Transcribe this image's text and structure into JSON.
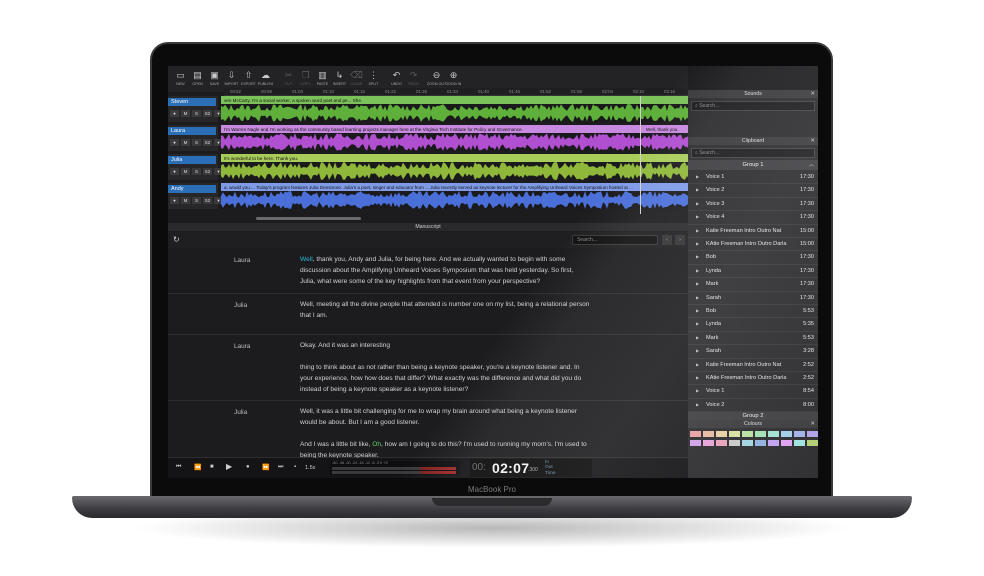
{
  "device": {
    "label": "MacBook Pro"
  },
  "toolbar": [
    {
      "icon": "new-icon",
      "glyph": "▭",
      "label": "NEW",
      "enabled": true
    },
    {
      "icon": "open-icon",
      "glyph": "▤",
      "label": "OPEN",
      "enabled": true
    },
    {
      "icon": "save-icon",
      "glyph": "▣",
      "label": "SAVE",
      "enabled": true
    },
    {
      "icon": "import-icon",
      "glyph": "⇩",
      "label": "IMPORT",
      "enabled": true
    },
    {
      "icon": "export-icon",
      "glyph": "⇧",
      "label": "EXPORT",
      "enabled": true
    },
    {
      "icon": "publish-icon",
      "glyph": "☁",
      "label": "PUBLISH",
      "enabled": true
    },
    {
      "icon": "cut-icon",
      "glyph": "✂",
      "label": "CUT",
      "enabled": false
    },
    {
      "icon": "copy-icon",
      "glyph": "❐",
      "label": "COPY",
      "enabled": false
    },
    {
      "icon": "paste-icon",
      "glyph": "▥",
      "label": "PASTE",
      "enabled": true
    },
    {
      "icon": "insert-icon",
      "glyph": "↳",
      "label": "INSERT",
      "enabled": true
    },
    {
      "icon": "clear-icon",
      "glyph": "⌫",
      "label": "CLEAR",
      "enabled": false
    },
    {
      "icon": "split-icon",
      "glyph": "⋮",
      "label": "SPLIT",
      "enabled": true
    },
    {
      "icon": "undo-icon",
      "glyph": "↶",
      "label": "UNDO",
      "enabled": true
    },
    {
      "icon": "redo-icon",
      "glyph": "↷",
      "label": "REDO",
      "enabled": false
    },
    {
      "icon": "zoom-out-icon",
      "glyph": "⊖",
      "label": "ZOOM OUT",
      "enabled": true
    },
    {
      "icon": "zoom-in-icon",
      "glyph": "⊕",
      "label": "ZOOM IN",
      "enabled": true
    }
  ],
  "ruler_ticks": [
    "00:52",
    "00:58",
    "01:04",
    "01:10",
    "01:16",
    "01:22",
    "01:28",
    "01:34",
    "01:40",
    "01:46",
    "01:52",
    "01:58",
    "02:04",
    "02:10",
    "02:16"
  ],
  "tracks": [
    {
      "name": "Steven",
      "color": "#5fb03a",
      "label_bg": "#7cc25a",
      "text": "ven McCarty. I'm a social worker, a spoken word poet and pe... She.",
      "text2": ""
    },
    {
      "name": "Laura",
      "color": "#b04fd0",
      "label_bg": "#c88ae0",
      "text": "I'm Warren Nagle and I'm working as the community based learning projects manager here at the Virginia Tech Institute for Policy and Governance.",
      "text2": "Well, thank you."
    },
    {
      "name": "Julia",
      "color": "#8fb83a",
      "label_bg": "#a8cc5a",
      "text": "It's wonderful to be here. Thank you.",
      "text2": ""
    },
    {
      "name": "Andy",
      "color": "#4a6fd8",
      "label_bg": "#7f9be8",
      "text": "a, would you ... Today's program features Julia Densmore. Julia's a poet, singer and educator from ... Julia recently served as keynote lecturer for the Amplifying Unheard Voices Symposium hosted at ...",
      "text2": ""
    }
  ],
  "track_buttons": [
    "●",
    "M",
    "S",
    "S2",
    "▾"
  ],
  "manuscript": {
    "title": "Manuscript",
    "search_placeholder": "Search...",
    "paragraphs": [
      {
        "speaker": "Laura",
        "lines": [
          [
            {
              "t": "Well",
              "c": "hl"
            },
            {
              "t": ", thank you, Andy and Julia, for being here. And we actually wanted to begin with some"
            }
          ],
          [
            {
              "t": "discussion about the Amplifying Unheard Voices Symposium that was held yesterday. So first,"
            }
          ],
          [
            {
              "t": "Julia, what were some of the key highlights from that event from your perspective?"
            }
          ]
        ]
      },
      {
        "speaker": "Julia",
        "lines": [
          [
            {
              "t": "Well, meeting all the divine people that attended is number one on my list, being a relational person"
            }
          ],
          [
            {
              "t": "that I am."
            }
          ]
        ]
      },
      {
        "speaker": "Laura",
        "lines": [
          [
            {
              "t": "Okay. And it was an interesting"
            }
          ],
          [
            {
              "t": ""
            }
          ],
          [
            {
              "t": "thing to think about as not rather than being a keynote speaker, you're a keynote listener and. In"
            }
          ],
          [
            {
              "t": "your experience, how how does that differ? What exactly was the difference and what did you do"
            }
          ],
          [
            {
              "t": "instead of being a keynote speaker as a keynote listener?"
            }
          ]
        ]
      },
      {
        "speaker": "Julia",
        "lines": [
          [
            {
              "t": "Well, it was a little bit challenging for me to wrap my brain around what being a keynote listener"
            }
          ],
          [
            {
              "t": "would be about. But I am a good listener."
            }
          ],
          [
            {
              "t": ""
            }
          ],
          [
            {
              "t": "And I was a little bit like, "
            },
            {
              "t": "Oh",
              "c": "gr"
            },
            {
              "t": ", how am I going to do this? I'm used to running my mom's. I'm used to"
            }
          ],
          [
            {
              "t": "being the keynote speaker."
            }
          ]
        ]
      }
    ]
  },
  "transport": {
    "rate": "1.5x",
    "meter_scale": "-60  -48  -30  -24  -18    -12  -6   -3  0   +3",
    "time_left": "00:",
    "time_main": "02:07",
    "time_ms": ".300",
    "in_label": "In",
    "out_label": "Out",
    "time_label": "Time"
  },
  "sounds": {
    "title": "Sounds",
    "search_placeholder": "Search..."
  },
  "clipboard": {
    "title": "Clipboard",
    "search_placeholder": "Search...",
    "group1": "Group 1",
    "group2": "Group 2",
    "items": [
      {
        "name": "Voice 1",
        "dur": "17:30"
      },
      {
        "name": "Voice 2",
        "dur": "17:30"
      },
      {
        "name": "Voice 3",
        "dur": "17:30"
      },
      {
        "name": "Voice 4",
        "dur": "17:30"
      },
      {
        "name": "Katie Freeman Intro Outro Nat",
        "dur": "15:00"
      },
      {
        "name": "KAtie Freeman Intro Outro Darla",
        "dur": "15:00"
      },
      {
        "name": "Bob",
        "dur": "17:30"
      },
      {
        "name": "Lynda",
        "dur": "17:30"
      },
      {
        "name": "Mark",
        "dur": "17:30"
      },
      {
        "name": "Sarah",
        "dur": "17:30"
      },
      {
        "name": "Bob",
        "dur": "5:53"
      },
      {
        "name": "Lynda",
        "dur": "5:35"
      },
      {
        "name": "Mark",
        "dur": "5:53"
      },
      {
        "name": "Sarah",
        "dur": "3:28"
      },
      {
        "name": "Katie Freeman Intro Outro Nat",
        "dur": "2:52"
      },
      {
        "name": "KAtie Freeman Intro Outro Darla",
        "dur": "2:52"
      },
      {
        "name": "Voice 1",
        "dur": "8:54"
      },
      {
        "name": "Voice 2",
        "dur": "8:00"
      }
    ]
  },
  "colours": {
    "title": "Colours",
    "swatches": [
      "#e8a0a0",
      "#e8b8a0",
      "#e8d0a0",
      "#d8e0a0",
      "#b8e0a0",
      "#a0e0b0",
      "#a0e0d0",
      "#a0d0e8",
      "#a0b0e8",
      "#b0a0e8",
      "#d0a0e8",
      "#e8a0d8",
      "#e8a0b8",
      "#c9c9c9",
      "#9fd4e0",
      "#8fb0e0",
      "#c0a0f0",
      "#e0a0f0",
      "#a0e0e0",
      "#b0d070"
    ]
  }
}
